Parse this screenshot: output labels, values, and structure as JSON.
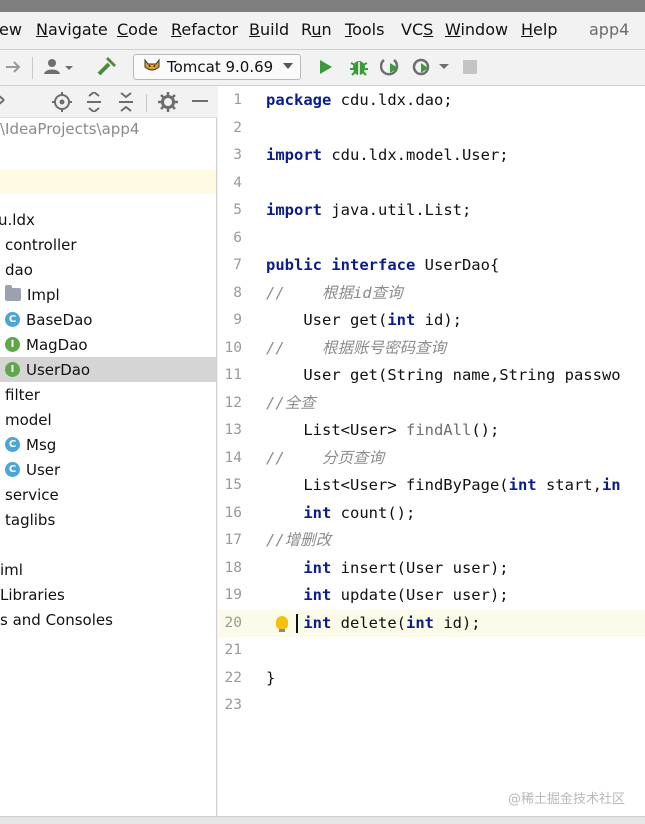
{
  "menu": {
    "items": [
      {
        "pre": "",
        "u": "",
        "post": "ew"
      },
      {
        "pre": "",
        "u": "N",
        "post": "avigate"
      },
      {
        "pre": "",
        "u": "C",
        "post": "ode"
      },
      {
        "pre": "",
        "u": "R",
        "post": "efactor"
      },
      {
        "pre": "",
        "u": "B",
        "post": "uild"
      },
      {
        "pre": "R",
        "u": "u",
        "post": "n"
      },
      {
        "pre": "",
        "u": "T",
        "post": "ools"
      },
      {
        "pre": "VC",
        "u": "S",
        "post": ""
      },
      {
        "pre": "",
        "u": "W",
        "post": "indow"
      },
      {
        "pre": "",
        "u": "H",
        "post": "elp"
      }
    ],
    "app_title": "app4"
  },
  "toolbar": {
    "run_config": "Tomcat 9.0.69",
    "icons": [
      "forward-arrow-icon",
      "user-dropdown-icon",
      "hammer-icon",
      "run-icon",
      "debug-icon",
      "coverage-icon",
      "profile-icon",
      "stop-icon"
    ]
  },
  "project": {
    "path": "\\IdeaProjects\\app4",
    "rows": [
      {
        "label": "u.ldx",
        "icon": "none",
        "selected": false
      },
      {
        "label": "controller",
        "icon": "none",
        "selected": false
      },
      {
        "label": "dao",
        "icon": "none",
        "selected": false
      },
      {
        "label": "Impl",
        "icon": "folder",
        "selected": false
      },
      {
        "label": "BaseDao",
        "icon": "class",
        "selected": false
      },
      {
        "label": "MagDao",
        "icon": "interface",
        "selected": false
      },
      {
        "label": "UserDao",
        "icon": "interface",
        "selected": true
      },
      {
        "label": "filter",
        "icon": "none",
        "selected": false
      },
      {
        "label": "model",
        "icon": "none",
        "selected": false
      },
      {
        "label": "Msg",
        "icon": "class",
        "selected": false
      },
      {
        "label": "User",
        "icon": "class",
        "selected": false
      },
      {
        "label": "service",
        "icon": "none",
        "selected": false
      },
      {
        "label": "taglibs",
        "icon": "none",
        "selected": false
      },
      {
        "label": "",
        "icon": "none",
        "selected": false
      },
      {
        "label": "iml",
        "icon": "none",
        "selected": false
      },
      {
        "label": "Libraries",
        "icon": "none",
        "selected": false
      },
      {
        "label": "s and Consoles",
        "icon": "none",
        "selected": false
      }
    ]
  },
  "editor": {
    "current_line": 20,
    "lines": [
      {
        "n": "1",
        "tokens": [
          {
            "t": "package",
            "k": "kw"
          },
          {
            "t": " cdu.ldx.dao;",
            "k": ""
          }
        ]
      },
      {
        "n": "2",
        "tokens": []
      },
      {
        "n": "3",
        "tokens": [
          {
            "t": "import",
            "k": "kw"
          },
          {
            "t": " cdu.ldx.model.User;",
            "k": ""
          }
        ]
      },
      {
        "n": "4",
        "tokens": []
      },
      {
        "n": "5",
        "tokens": [
          {
            "t": "import",
            "k": "kw"
          },
          {
            "t": " java.util.List;",
            "k": ""
          }
        ]
      },
      {
        "n": "6",
        "tokens": []
      },
      {
        "n": "7",
        "tokens": [
          {
            "t": "public interface",
            "k": "kw"
          },
          {
            "t": " UserDao{",
            "k": ""
          }
        ]
      },
      {
        "n": "8",
        "tokens": [
          {
            "t": "//    根据id查询",
            "k": "cm"
          }
        ]
      },
      {
        "n": "9",
        "tokens": [
          {
            "t": "    User get(",
            "k": ""
          },
          {
            "t": "int",
            "k": "kw"
          },
          {
            "t": " id);",
            "k": ""
          }
        ]
      },
      {
        "n": "10",
        "tokens": [
          {
            "t": "//    根据账号密码查询",
            "k": "cm"
          }
        ]
      },
      {
        "n": "11",
        "tokens": [
          {
            "t": "    User get(String name,String passwo",
            "k": ""
          }
        ]
      },
      {
        "n": "12",
        "tokens": [
          {
            "t": "//全查",
            "k": "cm"
          }
        ]
      },
      {
        "n": "13",
        "tokens": [
          {
            "t": "    List<User> ",
            "k": ""
          },
          {
            "t": "findAll",
            "k": "gr"
          },
          {
            "t": "();",
            "k": ""
          }
        ]
      },
      {
        "n": "14",
        "tokens": [
          {
            "t": "//    分页查询",
            "k": "cm"
          }
        ]
      },
      {
        "n": "15",
        "tokens": [
          {
            "t": "    List<User> findByPage(",
            "k": ""
          },
          {
            "t": "int",
            "k": "kw"
          },
          {
            "t": " start,",
            "k": ""
          },
          {
            "t": "in",
            "k": "kw"
          }
        ]
      },
      {
        "n": "16",
        "tokens": [
          {
            "t": "    ",
            "k": ""
          },
          {
            "t": "int",
            "k": "kw"
          },
          {
            "t": " count();",
            "k": ""
          }
        ]
      },
      {
        "n": "17",
        "tokens": [
          {
            "t": "//增删改",
            "k": "cm"
          }
        ]
      },
      {
        "n": "18",
        "tokens": [
          {
            "t": "    ",
            "k": ""
          },
          {
            "t": "int",
            "k": "kw"
          },
          {
            "t": " insert(User user);",
            "k": ""
          }
        ]
      },
      {
        "n": "19",
        "tokens": [
          {
            "t": "    ",
            "k": ""
          },
          {
            "t": "int",
            "k": "kw"
          },
          {
            "t": " update(User user);",
            "k": ""
          }
        ]
      },
      {
        "n": "20",
        "tokens": [
          {
            "t": "    ",
            "k": ""
          },
          {
            "t": "int",
            "k": "kw"
          },
          {
            "t": " delete(",
            "k": ""
          },
          {
            "t": "int",
            "k": "kw"
          },
          {
            "t": " id);",
            "k": ""
          }
        ]
      },
      {
        "n": "21",
        "tokens": []
      },
      {
        "n": "22",
        "tokens": [
          {
            "t": "}",
            "k": ""
          }
        ]
      },
      {
        "n": "23",
        "tokens": []
      }
    ]
  },
  "watermark": "@稀土掘金技术社区",
  "colors": {
    "keyword": "#0b1d8a",
    "comment": "#8c8c8c",
    "current_line": "#fcfae8",
    "selected_row": "#d5d5d5"
  }
}
